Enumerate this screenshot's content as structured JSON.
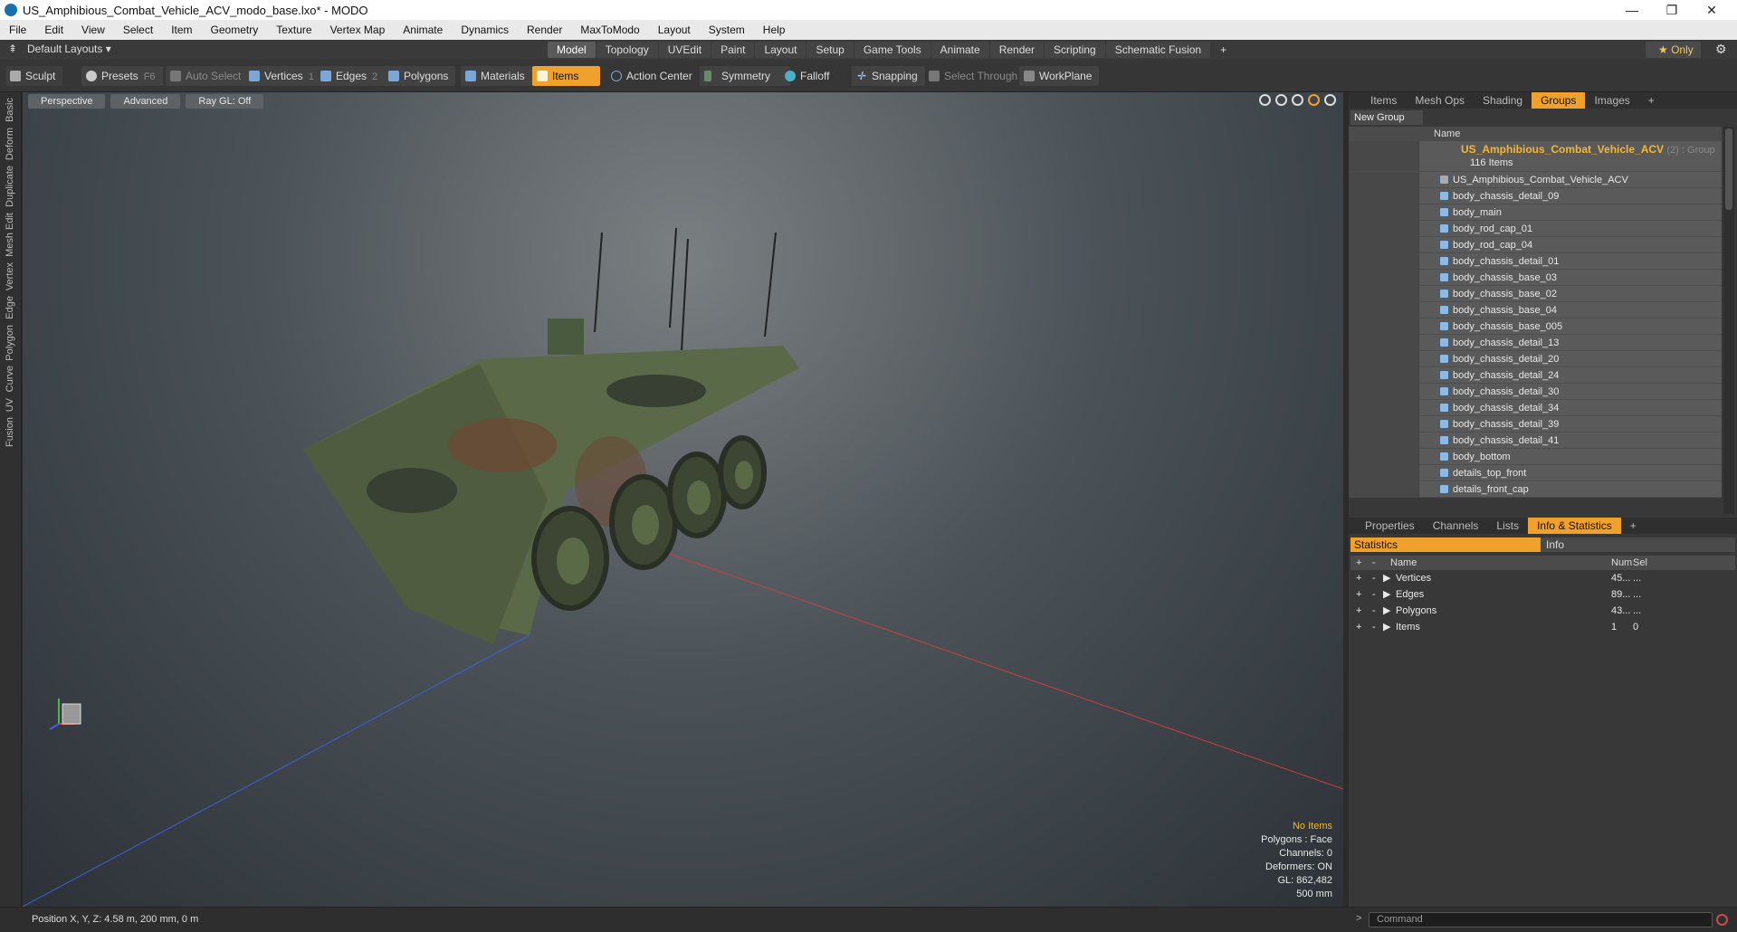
{
  "window": {
    "title": "US_Amphibious_Combat_Vehicle_ACV_modo_base.lxo* - MODO"
  },
  "menu": [
    "File",
    "Edit",
    "View",
    "Select",
    "Item",
    "Geometry",
    "Texture",
    "Vertex Map",
    "Animate",
    "Dynamics",
    "Render",
    "MaxToModo",
    "Layout",
    "System",
    "Help"
  ],
  "layout_selector": "Default Layouts",
  "mode_tabs": [
    "Model",
    "Topology",
    "UVEdit",
    "Paint",
    "Layout",
    "Setup",
    "Game Tools",
    "Animate",
    "Render",
    "Scripting",
    "Schematic Fusion"
  ],
  "active_mode_tab": "Model",
  "only_label": "Only",
  "toolbar": {
    "sculpt": "Sculpt",
    "presets": "Presets",
    "presets_key": "F6",
    "auto_select": "Auto Select",
    "vertices": "Vertices",
    "vertices_key": "1",
    "edges": "Edges",
    "edges_key": "2",
    "polygons": "Polygons",
    "materials": "Materials",
    "items": "Items",
    "action_center": "Action Center",
    "symmetry": "Symmetry",
    "falloff": "Falloff",
    "snapping": "Snapping",
    "select_through": "Select Through",
    "workplane": "WorkPlane"
  },
  "left_strip": [
    "Basic",
    "Deform",
    "Duplicate",
    "Mesh Edit",
    "Vertex",
    "Edge",
    "Polygon",
    "Curve",
    "UV",
    "Fusion"
  ],
  "viewport": {
    "view_mode": "Perspective",
    "shading": "Advanced",
    "raygl": "Ray GL: Off",
    "stats": {
      "no_items": "No Items",
      "polygons": "Polygons : Face",
      "channels": "Channels: 0",
      "deformers": "Deformers: ON",
      "gl": "GL: 862,482",
      "grid": "500 mm"
    }
  },
  "status_bar": "Position X, Y, Z:  4.58 m, 200 mm, 0 m",
  "groups_panel": {
    "tabs": [
      "Items",
      "Mesh Ops",
      "Shading",
      "Groups",
      "Images"
    ],
    "active_tab": "Groups",
    "new_group": "New Group",
    "name_header": "Name",
    "group_name": "US_Amphibious_Combat_Vehicle_ACV",
    "group_suffix": "(2) : Group",
    "group_count": "116 Items",
    "items": [
      "US_Amphibious_Combat_Vehicle_ACV",
      "body_chassis_detail_09",
      "body_main",
      "body_rod_cap_01",
      "body_rod_cap_04",
      "body_chassis_detail_01",
      "body_chassis_base_03",
      "body_chassis_base_02",
      "body_chassis_base_04",
      "body_chassis_base_005",
      "body_chassis_detail_13",
      "body_chassis_detail_20",
      "body_chassis_detail_24",
      "body_chassis_detail_30",
      "body_chassis_detail_34",
      "body_chassis_detail_39",
      "body_chassis_detail_41",
      "body_bottom",
      "details_top_front",
      "details_front_cap"
    ]
  },
  "info_panel": {
    "tabs": [
      "Properties",
      "Channels",
      "Lists",
      "Info & Statistics"
    ],
    "active_tab": "Info & Statistics",
    "sub_tabs": [
      "Statistics",
      "Info"
    ],
    "headers": {
      "name": "Name",
      "num": "Num",
      "sel": "Sel"
    },
    "rows": [
      {
        "name": "Vertices",
        "num": "45...",
        "sel": "..."
      },
      {
        "name": "Edges",
        "num": "89...",
        "sel": "..."
      },
      {
        "name": "Polygons",
        "num": "43...",
        "sel": "..."
      },
      {
        "name": "Items",
        "num": "1",
        "sel": "0"
      }
    ]
  },
  "command": {
    "placeholder": "Command"
  },
  "colors": {
    "accent": "#f0a12b",
    "highlight_text": "#f5b635"
  }
}
